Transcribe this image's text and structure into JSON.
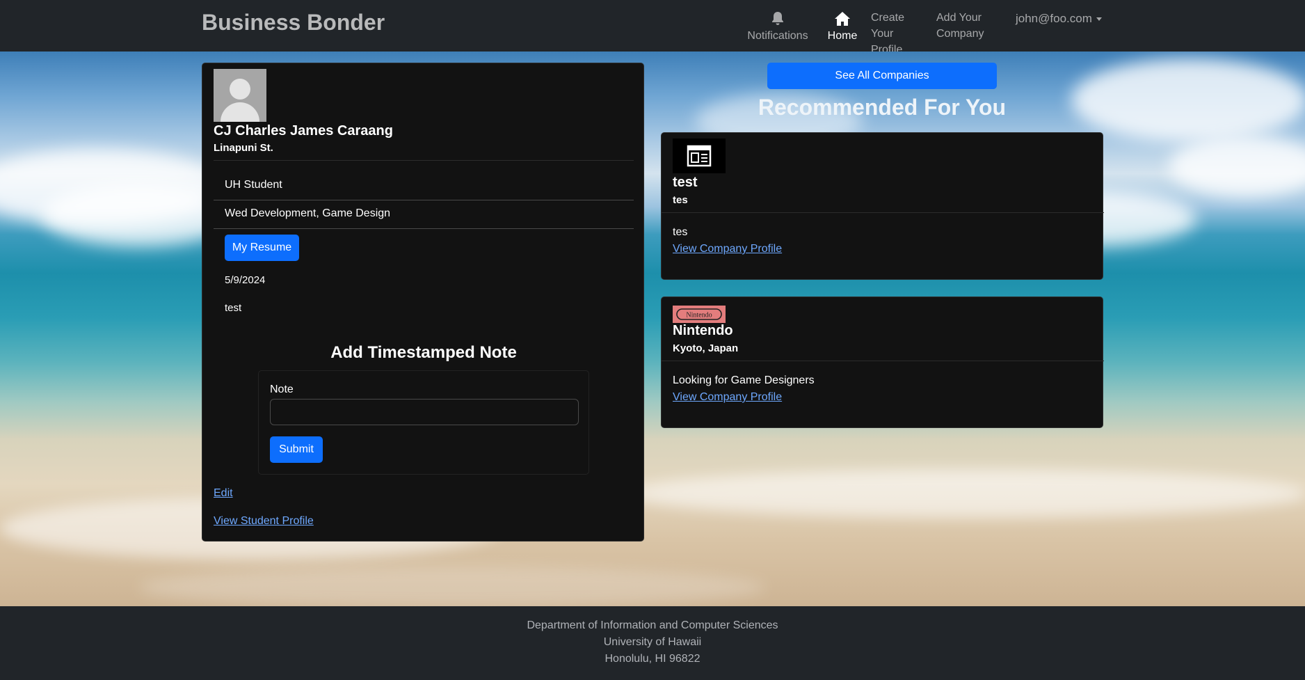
{
  "navbar": {
    "brand": "Business Bonder",
    "notifications_label": "Notifications",
    "home_label": "Home",
    "create_profile_label_1": "Create Your",
    "create_profile_label_2": "Profile",
    "add_company_label_1": "Add Your",
    "add_company_label_2": "Company",
    "user_email": "john@foo.com"
  },
  "student": {
    "name": "CJ Charles James Caraang",
    "address": "Linapuni St.",
    "title": "UH Student",
    "interests": "Wed Development, Game Design",
    "resume_button": "My Resume",
    "note_date": "5/9/2024",
    "note_text": "test",
    "add_note_title": "Add Timestamped Note",
    "note_label": "Note",
    "note_value": "",
    "submit_button": "Submit",
    "edit_link": "Edit",
    "view_profile_link": "View Student Profile"
  },
  "companies_section": {
    "see_all_button": "See All Companies",
    "title": "Recommended For You",
    "companies": [
      {
        "name": "test",
        "location": "tes",
        "description": "tes",
        "link": "View Company Profile",
        "logo_icon": "newspaper-icon"
      },
      {
        "name": "Nintendo",
        "location": "Kyoto, Japan",
        "description": "Looking for Game Designers",
        "link": "View Company Profile",
        "logo_text": "Nintendo"
      }
    ]
  },
  "footer": {
    "line1": "Department of Information and Computer Sciences",
    "line2": "University of Hawaii",
    "line3": "Honolulu, HI 96822"
  },
  "colors": {
    "accent": "#0d6efd",
    "navbar": "#212529",
    "card": "#121212",
    "link": "#6ea8fe"
  }
}
